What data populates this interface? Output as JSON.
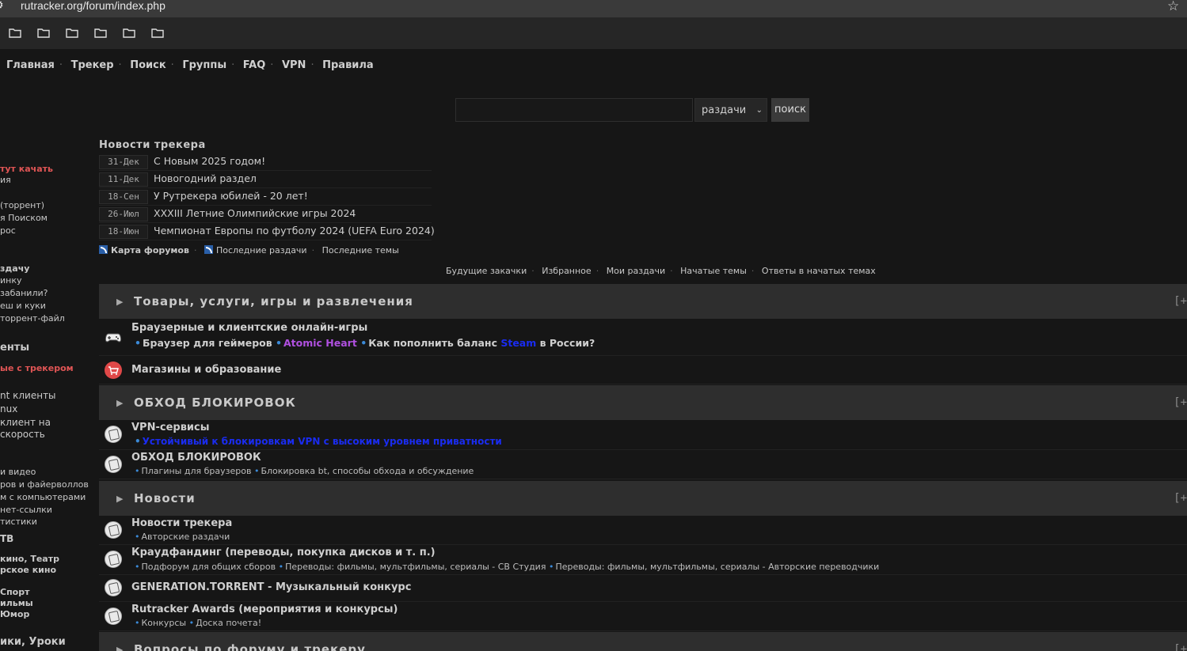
{
  "browser": {
    "url": "rutracker.org/forum/index.php",
    "bookmark_folders": [
      "folder-icon",
      "folder-icon",
      "folder-icon",
      "folder-icon",
      "folder-icon",
      "folder-icon"
    ]
  },
  "nav": {
    "items": [
      "Главная",
      "Трекер",
      "Поиск",
      "Группы",
      "FAQ",
      "VPN",
      "Правила"
    ]
  },
  "search": {
    "placeholder": "",
    "scope": "раздачи",
    "button": "поиск"
  },
  "sidebar": [
    {
      "text": "тут качать",
      "style": "red"
    },
    {
      "text": "ия",
      "style": ""
    },
    {
      "text": "(торрент)",
      "style": ""
    },
    {
      "text": "я Поиском",
      "style": ""
    },
    {
      "text": "рос",
      "style": ""
    },
    {
      "text": "здачу",
      "style": "bold"
    },
    {
      "text": "инку",
      "style": ""
    },
    {
      "text": "забанили?",
      "style": ""
    },
    {
      "text": "еш и куки",
      "style": ""
    },
    {
      "text": "торрент-файл",
      "style": ""
    },
    {
      "text": "енты",
      "style": "head"
    },
    {
      "text": "ые с трекером",
      "style": "red"
    },
    {
      "text": "nt клиенты",
      "style": ""
    },
    {
      "text": "nux",
      "style": ""
    },
    {
      "text": "клиент на",
      "style": ""
    },
    {
      "text": "скорость",
      "style": ""
    },
    {
      "text": "и видео",
      "style": ""
    },
    {
      "text": "ров и файерволлов",
      "style": ""
    },
    {
      "text": "м с компьютерами",
      "style": ""
    },
    {
      "text": "нет-ссылки",
      "style": ""
    },
    {
      "text": "тистики",
      "style": ""
    },
    {
      "text": "ТВ",
      "style": "bold"
    },
    {
      "text": "кино, Театр",
      "style": "bold"
    },
    {
      "text": "рское кино",
      "style": "bold"
    },
    {
      "text": "Спорт",
      "style": "bold"
    },
    {
      "text": "ильмы",
      "style": "bold"
    },
    {
      "text": "Юмор",
      "style": "bold"
    },
    {
      "text": "ики, Уроки",
      "style": "head"
    }
  ],
  "news": {
    "title": "Новости трекера",
    "items": [
      {
        "date": "31-Дек",
        "text": "С Новым 2025 годом!"
      },
      {
        "date": "11-Дек",
        "text": "Новогодний раздел"
      },
      {
        "date": "18-Сен",
        "text": "У Рутрекера юбилей - 20 лет!"
      },
      {
        "date": "26-Июл",
        "text": "XXXIII Летние Олимпийские игры 2024"
      },
      {
        "date": "18-Июн",
        "text": "Чемпионат Европы по футболу 2024 (UEFA Euro 2024)"
      }
    ],
    "feeds": [
      "Карта форумов",
      "Последние раздачи",
      "Последние темы"
    ]
  },
  "user_links": [
    "Будущие закачки",
    "Избранное",
    "Мои раздачи",
    "Начатые темы",
    "Ответы в начатых темах"
  ],
  "categories": [
    {
      "title": "Товары, услуги, игры и развлечения",
      "expand": "[+",
      "forums": [
        {
          "title": "Браузерные и клиентские онлайн-игры",
          "icon": "gamepad-icon",
          "sub_parts": [
            "Браузер для геймеров",
            "Atomic Heart",
            "Как пополнить баланс",
            "Steam",
            "в России?"
          ]
        },
        {
          "title": "Магазины и образование",
          "icon": "shop-cart-icon"
        }
      ]
    },
    {
      "title": "ОБХОД БЛОКИРОВОК",
      "expand": "[+",
      "forums": [
        {
          "title": "VPN-сервисы",
          "icon": "ticket-icon",
          "sub": [
            "Устойчивый к блокировкам VPN с высоким уровнем приватности"
          ]
        },
        {
          "title": "ОБХОД БЛОКИРОВОК",
          "icon": "ticket-icon",
          "sub": [
            "Плагины для браузеров",
            "Блокировка bt, способы обхода и обсуждение"
          ]
        }
      ]
    },
    {
      "title": "Новости",
      "expand": "[+",
      "forums": [
        {
          "title": "Новости трекера",
          "icon": "ticket-icon",
          "sub": [
            "Авторские раздачи"
          ]
        },
        {
          "title": "Краудфандинг (переводы, покупка дисков и т. п.)",
          "icon": "ticket-icon",
          "sub": [
            "Подфорум для общих сборов",
            "Переводы: фильмы, мультфильмы, сериалы - СВ Студия",
            "Переводы: фильмы, мультфильмы, сериалы - Авторские переводчики"
          ]
        },
        {
          "title": "GENERATION.TORRENT - Музыкальный конкурс",
          "icon": "ticket-icon"
        },
        {
          "title": "Rutracker Awards (мероприятия и конкурсы)",
          "icon": "ticket-icon",
          "sub": [
            "Конкурсы",
            "Доска почета!"
          ]
        }
      ]
    },
    {
      "title": "Вопросы по форуму и трекеру",
      "expand": "[+"
    }
  ],
  "colors": {
    "accent_red": "#e05555",
    "link_blue": "#1a2cf0",
    "purple": "#b050e0",
    "bullet_blue": "#3b8ad8"
  }
}
